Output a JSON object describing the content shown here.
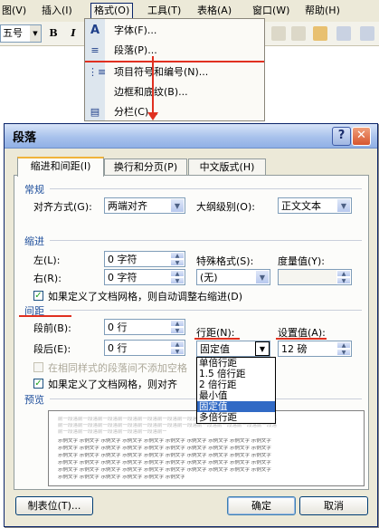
{
  "menubar": {
    "items": [
      {
        "label": "图(V)"
      },
      {
        "label": "插入(I)"
      },
      {
        "label": "格式(O)"
      },
      {
        "label": "工具(T)"
      },
      {
        "label": "表格(A)"
      },
      {
        "label": "窗口(W)"
      },
      {
        "label": "帮助(H)"
      }
    ]
  },
  "toolbar": {
    "font_size": "五号",
    "bold": "B",
    "italic": "I"
  },
  "format_menu": {
    "items": [
      {
        "label": "字体(F)...",
        "icon": "font-icon",
        "glyph": "A"
      },
      {
        "label": "段落(P)...",
        "icon": "paragraph-icon",
        "glyph": "≡"
      },
      {
        "label": "项目符号和编号(N)...",
        "icon": "bullets-icon",
        "glyph": "⋮≡"
      },
      {
        "label": "边框和底纹(B)...",
        "icon": "",
        "glyph": ""
      },
      {
        "label": "分栏(C)...",
        "icon": "columns-icon",
        "glyph": "▤"
      }
    ]
  },
  "dialog": {
    "title": "段落",
    "help": "?",
    "close": "✕",
    "tabs": [
      "缩进和间距(I)",
      "换行和分页(P)",
      "中文版式(H)"
    ],
    "general": {
      "title": "常规",
      "alignment_label": "对齐方式(G):",
      "alignment_value": "两端对齐",
      "outline_label": "大纲级别(O):",
      "outline_value": "正文文本"
    },
    "indent": {
      "title": "缩进",
      "left_label": "左(L):",
      "left_value": "0 字符",
      "right_label": "右(R):",
      "right_value": "0 字符",
      "special_label": "特殊格式(S):",
      "special_value": "(无)",
      "by_label": "度量值(Y):",
      "by_value": "",
      "auto_adjust_label": "如果定义了文档网格，则自动调整右缩进(D)"
    },
    "spacing": {
      "title": "间距",
      "before_label": "段前(B):",
      "before_value": "0 行",
      "after_label": "段后(E):",
      "after_value": "0 行",
      "line_spacing_label": "行距(N):",
      "line_spacing_value": "固定值",
      "at_label": "设置值(A):",
      "at_value": "12 磅",
      "no_space_label": "在相同样式的段落间不添加空格",
      "snap_label": "如果定义了文档网格，则对齐",
      "line_options": [
        "单倍行距",
        "1.5 倍行距",
        "2 倍行距",
        "最小值",
        "固定值",
        "多倍行距"
      ],
      "selected_option": "固定值"
    },
    "preview": {
      "title": "预览",
      "prev_text": "前一段落前一段落前一段落前一段落前一段落前一段落前一段落前一段落前一段落前一段落前一段落",
      "sample_text": "示例文字 示例文字 示例文字 示例文字 示例文字 示例文字 示例文字 示例文字 示例文字 示例文字"
    },
    "buttons": {
      "tabs": "制表位(T)...",
      "ok": "确定",
      "cancel": "取消"
    }
  },
  "colors": {
    "annotation_red": "#e03020",
    "section_blue": "#1f4f9c",
    "selection_blue": "#316ac5"
  }
}
